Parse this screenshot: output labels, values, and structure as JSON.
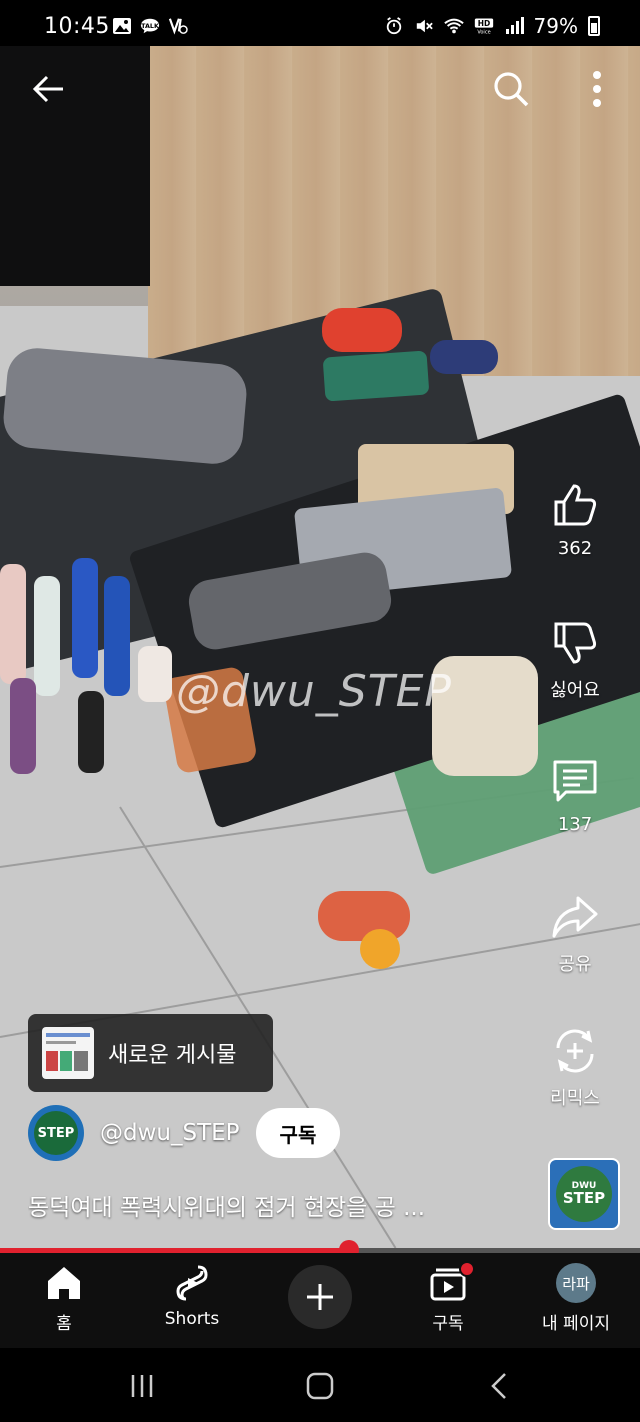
{
  "status_bar": {
    "time": "10:45",
    "left_icons": [
      "gallery-icon",
      "talk-icon",
      "vpn-icon"
    ],
    "right_icons": [
      "alarm-icon",
      "mute-icon",
      "wifi-icon",
      "hd-voice-icon",
      "signal-icon",
      "battery-icon"
    ],
    "battery_percent": "79%"
  },
  "top_bar": {
    "back_icon": "arrow-left-icon",
    "search_icon": "search-icon",
    "more_icon": "more-vertical-icon"
  },
  "video": {
    "watermark": "@dwu_STEP"
  },
  "actions": {
    "like": {
      "icon": "thumbs-up-icon",
      "label": "362"
    },
    "dislike": {
      "icon": "thumbs-down-icon",
      "label": "싫어요"
    },
    "comments": {
      "icon": "comment-icon",
      "label": "137"
    },
    "share": {
      "icon": "share-icon",
      "label": "공유"
    },
    "remix": {
      "icon": "remix-icon",
      "label": "리믹스"
    }
  },
  "new_post": {
    "label": "새로운 게시물"
  },
  "channel": {
    "avatar_text": "STEP",
    "name": "@dwu_STEP",
    "subscribe_label": "구독"
  },
  "video_title": "동덕여대 폭력시위대의 점거 현장을 공 ...",
  "sound_thumb": {
    "line1": "DWU",
    "line2": "STEP"
  },
  "progress": {
    "played_fraction": 0.545
  },
  "bottom_nav": {
    "home": "홈",
    "shorts": "Shorts",
    "subscriptions": "구독",
    "profile": "내 페이지",
    "profile_avatar_text": "라파"
  },
  "colors": {
    "accent_red": "#e0212e",
    "nav_bg": "#0f0f0f"
  }
}
